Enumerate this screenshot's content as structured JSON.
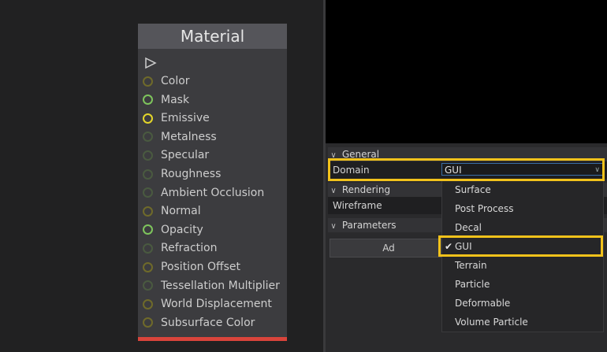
{
  "node": {
    "title": "Material",
    "pins": [
      {
        "label": "Color",
        "color": "#6f6a2a"
      },
      {
        "label": "Mask",
        "color": "#7ec45c"
      },
      {
        "label": "Emissive",
        "color": "#e3d52a"
      },
      {
        "label": "Metalness",
        "color": "#4a5a40"
      },
      {
        "label": "Specular",
        "color": "#4a5a40"
      },
      {
        "label": "Roughness",
        "color": "#4a5a40"
      },
      {
        "label": "Ambient Occlusion",
        "color": "#4a5a40"
      },
      {
        "label": "Normal",
        "color": "#6f6a2a"
      },
      {
        "label": "Opacity",
        "color": "#7ec45c"
      },
      {
        "label": "Refraction",
        "color": "#4a5a40"
      },
      {
        "label": "Position Offset",
        "color": "#6f6a2a"
      },
      {
        "label": "Tessellation Multiplier",
        "color": "#4a5a40"
      },
      {
        "label": "World Displacement",
        "color": "#6f6a2a"
      },
      {
        "label": "Subsurface Color",
        "color": "#6f6a2a"
      }
    ]
  },
  "properties": {
    "general": {
      "label": "General"
    },
    "domain": {
      "label": "Domain",
      "value": "GUI"
    },
    "rendering": {
      "label": "Rendering"
    },
    "wireframe": {
      "label": "Wireframe"
    },
    "parameters": {
      "label": "Parameters"
    },
    "add_button": "Ad"
  },
  "dropdown": {
    "options": [
      "Surface",
      "Post Process",
      "Decal",
      "GUI",
      "Terrain",
      "Particle",
      "Deformable",
      "Volume Particle"
    ],
    "selected": "GUI"
  },
  "colors": {
    "highlight": "#f2c21b",
    "node_footer": "#d9443b"
  }
}
